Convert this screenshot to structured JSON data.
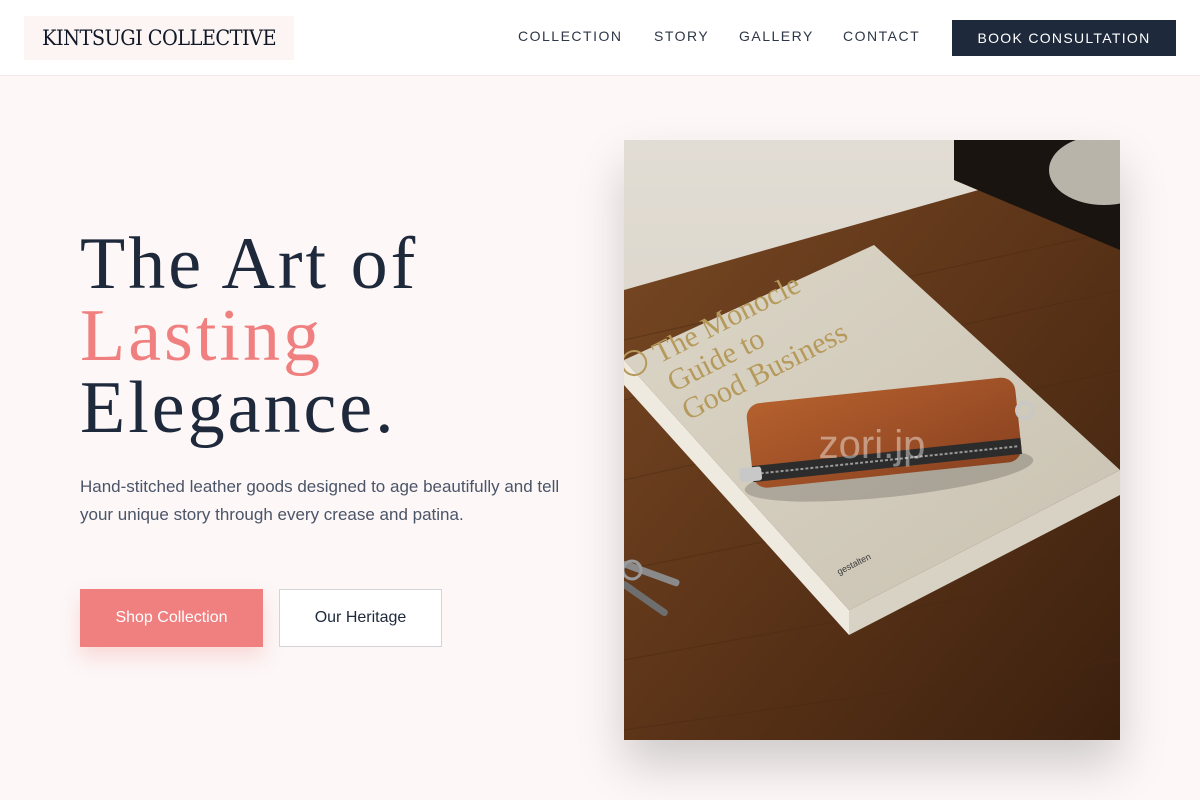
{
  "header": {
    "logo_text": "KINTSUGI COLLECTIVE",
    "nav": [
      {
        "label": "COLLECTION"
      },
      {
        "label": "STORY"
      },
      {
        "label": "GALLERY"
      },
      {
        "label": "CONTACT"
      }
    ],
    "cta_label": "BOOK CONSULTATION"
  },
  "hero": {
    "headline_line1": "The Art of",
    "headline_line2": "Lasting",
    "headline_line3": "Elegance.",
    "subtext": "Hand-stitched leather goods designed to age beautifully and tell your unique story through every crease and patina.",
    "primary_button": "Shop Collection",
    "secondary_button": "Our Heritage"
  },
  "image": {
    "book_title_line1": "The Monocle",
    "book_title_line2": "Guide to",
    "book_title_line3": "Good Business",
    "book_publisher": "gestalten",
    "watermark": "zori.jp"
  },
  "colors": {
    "accent": "#f08080",
    "dark": "#1e293b",
    "background": "#fdf7f7"
  }
}
